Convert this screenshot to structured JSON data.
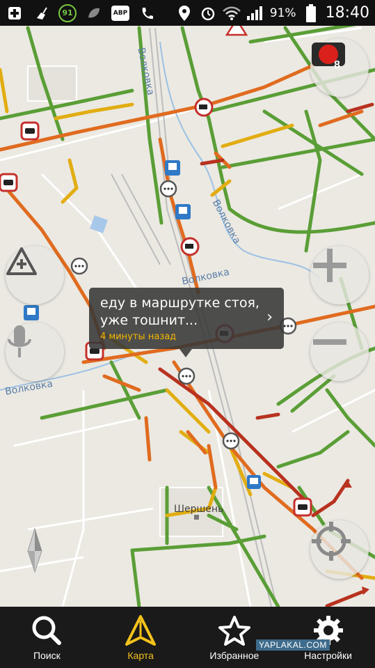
{
  "status_bar": {
    "badge_number": "91",
    "abp_label": "ABP",
    "battery_percent": "91%",
    "time": "18:40",
    "icons": [
      "plus-icon",
      "broom-icon",
      "badge-91-icon",
      "leaf-icon",
      "abp-icon",
      "phone-icon",
      "location-pin-icon",
      "alarm-icon",
      "wifi-icon",
      "signal-icon",
      "battery-icon"
    ]
  },
  "map": {
    "street_labels": [
      "Волковка",
      "Волковка",
      "Волковка",
      "Волковка"
    ],
    "poi_label": "Шершень",
    "traffic_light_count": "8",
    "colors": {
      "green": "#5a9e36",
      "yellow": "#e2ad12",
      "orange": "#e06b1f",
      "red": "#b8321f"
    }
  },
  "bubble": {
    "text": "еду в маршрутке стоя, уже тошнит...",
    "time": "4 минуты назад"
  },
  "bottom_nav": {
    "items": [
      {
        "label": "Поиск",
        "icon": "search-icon"
      },
      {
        "label": "Карта",
        "icon": "map-arrow-icon",
        "active": true
      },
      {
        "label": "Избранное",
        "icon": "star-icon"
      },
      {
        "label": "Настройки",
        "icon": "gear-icon"
      }
    ]
  },
  "watermark": "YAPLAKAL.COM"
}
